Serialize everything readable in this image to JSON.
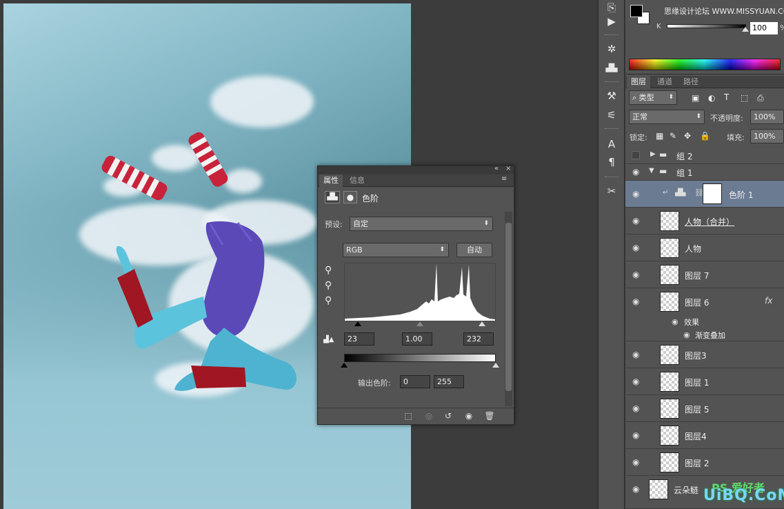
{
  "color_panel": {
    "channel_label": "K",
    "k_value": "100",
    "k_fraction": 0.95,
    "percent": "%",
    "header_watermark": "思缘设计论坛 WWW.MISSYUAN.COM"
  },
  "layers_panel": {
    "tabs": [
      "图层",
      "通道",
      "路径"
    ],
    "filter_kind": "类型",
    "blend_mode": "正常",
    "opacity_label": "不透明度:",
    "opacity_value": "100%",
    "lock_label": "锁定:",
    "fill_label": "填充:",
    "fill_value": "100%",
    "rows": [
      {
        "name": "组 2"
      },
      {
        "name": "组 1"
      },
      {
        "name": "色阶 1"
      },
      {
        "name": "人物（合并）"
      },
      {
        "name": "人物"
      },
      {
        "name": "图层 7"
      },
      {
        "name": "图层 6",
        "fx": "fx",
        "effects_label": "效果",
        "effect": "渐变叠加"
      },
      {
        "name": "图层3"
      },
      {
        "name": "图层 1"
      },
      {
        "name": "图层 5"
      },
      {
        "name": "图层4"
      },
      {
        "name": "图层 2"
      },
      {
        "name": "云朵鲢"
      }
    ]
  },
  "properties_panel": {
    "tabs": [
      "属性",
      "信息"
    ],
    "title": "色阶",
    "preset_label": "预设:",
    "preset_value": "自定",
    "channel_value": "RGB",
    "auto_button": "自动",
    "input_black": "23",
    "input_gamma": "1.00",
    "input_white": "232",
    "output_label": "输出色阶:",
    "output_black": "0",
    "output_white": "255"
  },
  "watermark": "UiBQ.CoM",
  "watermark2": "PS 爱好者"
}
